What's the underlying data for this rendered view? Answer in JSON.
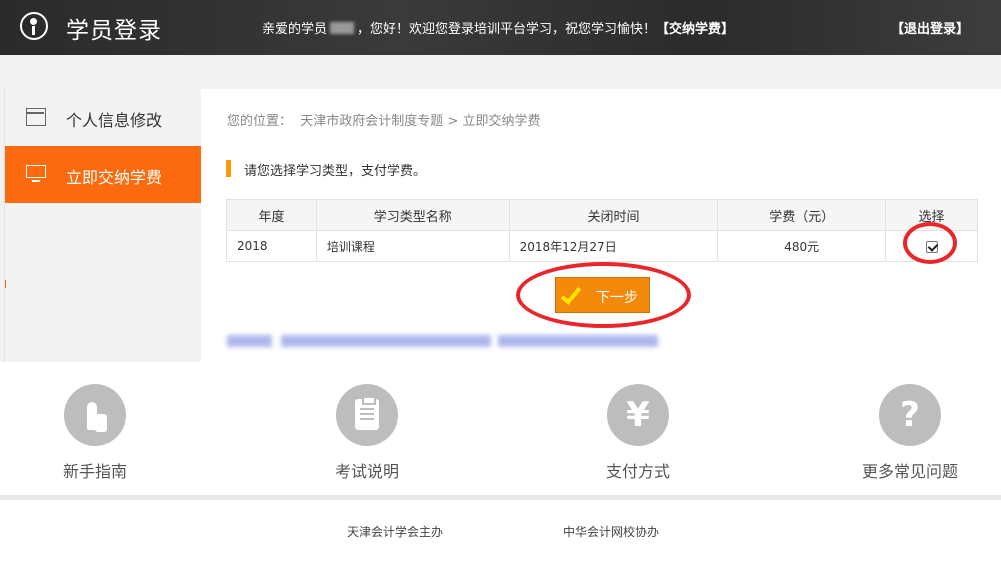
{
  "header": {
    "title": "学员登录",
    "welcome_prefix": "亲爱的学员",
    "welcome_suffix": "，您好！欢迎您登录培训平台学习，祝您学习愉快！",
    "welcome_highlight": "【交纳学费】",
    "logout": "【退出登录】"
  },
  "sidebar": {
    "items": [
      {
        "label": "个人信息修改",
        "icon": "form-icon",
        "active": false
      },
      {
        "label": "立即交纳学费",
        "icon": "monitor-icon",
        "active": true
      }
    ]
  },
  "breadcrumb": {
    "prefix": "您的位置：",
    "path1": "天津市政府会计制度专题",
    "sep": ">",
    "path2": "立即交纳学费"
  },
  "section_hint": "请您选择学习类型，支付学费。",
  "table": {
    "headers": [
      "年度",
      "学习类型名称",
      "关闭时间",
      "学费（元）",
      "选择"
    ],
    "rows": [
      {
        "year": "2018",
        "type": "培训课程",
        "close_time": "2018年12月27日",
        "fee": "480元",
        "selected": true
      }
    ]
  },
  "next_button": "下一步",
  "colors": {
    "accent": "#fb6a0e",
    "button": "#f48a0c",
    "annotation": "#e8262b"
  },
  "links": [
    {
      "label": "新手指南",
      "icon": "tap-icon"
    },
    {
      "label": "考试说明",
      "icon": "clipboard-icon"
    },
    {
      "label": "支付方式",
      "icon": "yen-icon"
    },
    {
      "label": "更多常见问题",
      "icon": "question-icon"
    }
  ],
  "footer": {
    "organizer": "天津会计学会主办",
    "co_organizer": "中华会计网校协办"
  }
}
